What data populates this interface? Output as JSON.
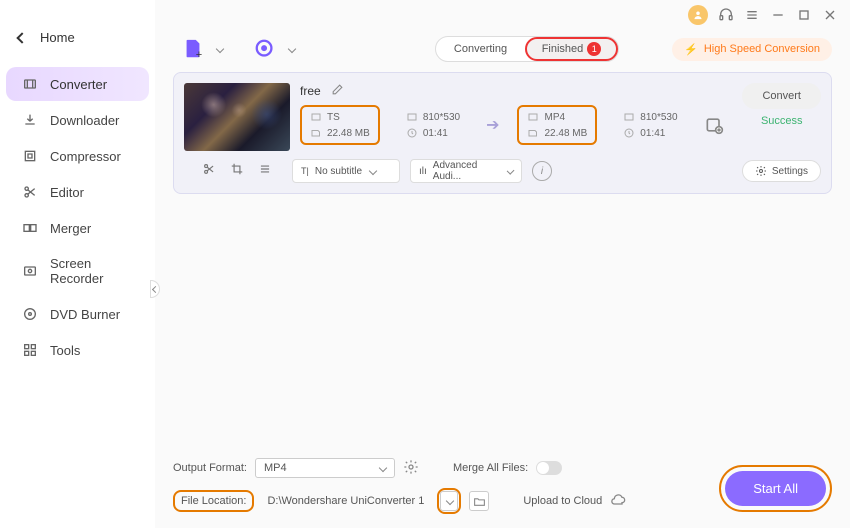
{
  "sidebar": {
    "home": "Home",
    "items": [
      {
        "label": "Converter"
      },
      {
        "label": "Downloader"
      },
      {
        "label": "Compressor"
      },
      {
        "label": "Editor"
      },
      {
        "label": "Merger"
      },
      {
        "label": "Screen Recorder"
      },
      {
        "label": "DVD Burner"
      },
      {
        "label": "Tools"
      }
    ]
  },
  "tabs": {
    "converting": "Converting",
    "finished": "Finished",
    "finished_count": "1"
  },
  "highspeed": "High Speed Conversion",
  "task": {
    "title": "free",
    "src": {
      "format": "TS",
      "res": "810*530",
      "size": "22.48 MB",
      "duration": "01:41"
    },
    "dst": {
      "format": "MP4",
      "res": "810*530",
      "size": "22.48 MB",
      "duration": "01:41"
    },
    "convert_label": "Convert",
    "status": "Success",
    "subtitle": "No subtitle",
    "audio": "Advanced Audi...",
    "settings_label": "Settings"
  },
  "footer": {
    "output_format_label": "Output Format:",
    "output_format": "MP4",
    "merge_label": "Merge All Files:",
    "location_label": "File Location:",
    "location_value": "D:\\Wondershare UniConverter 1",
    "upload_label": "Upload to Cloud",
    "start_all": "Start All"
  }
}
